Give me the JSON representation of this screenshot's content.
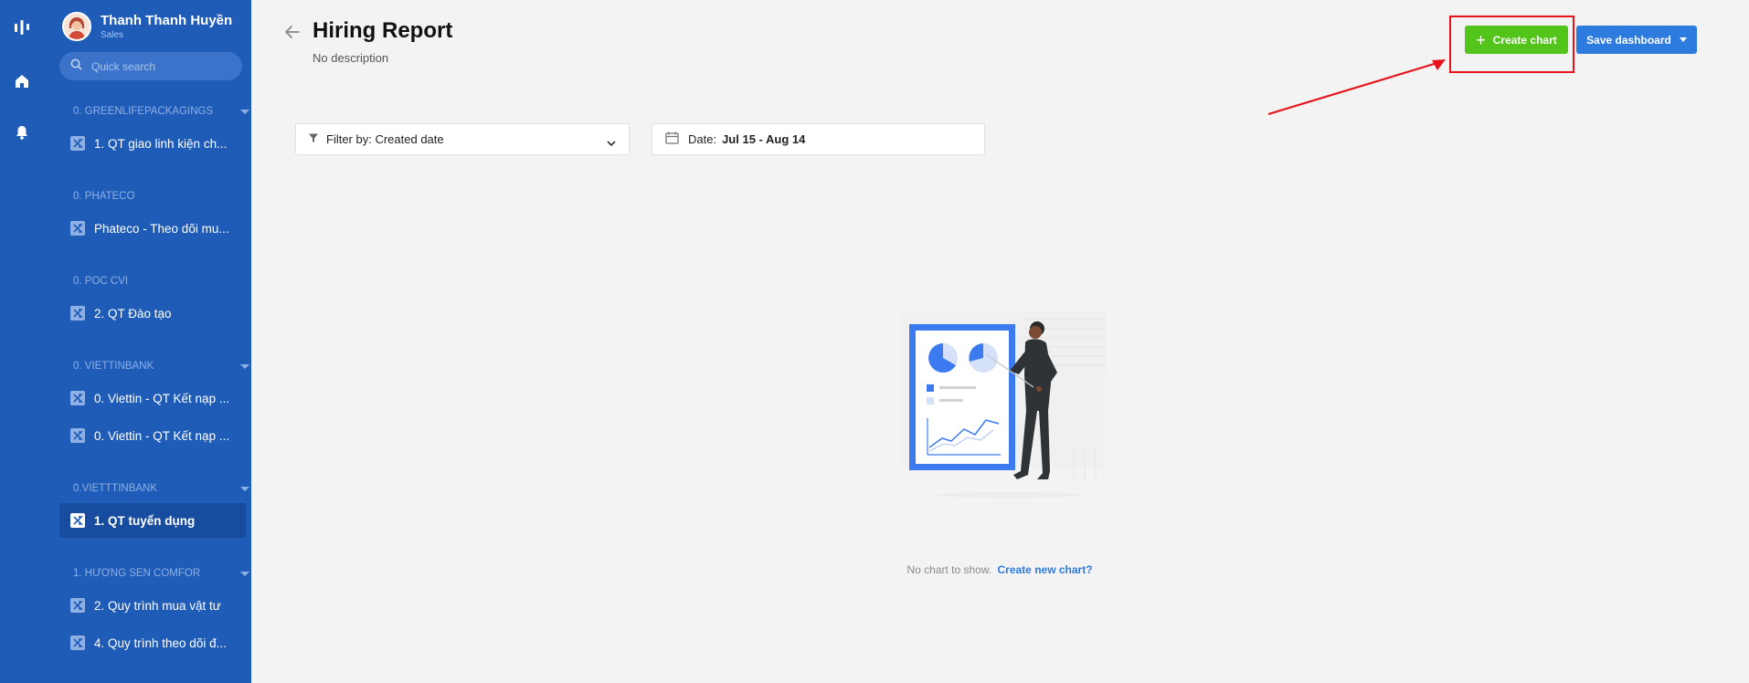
{
  "rail": {
    "icons": [
      "logo-icon",
      "home-icon",
      "bell-icon"
    ]
  },
  "user": {
    "name": "Thanh Thanh Huyền",
    "role": "Sales"
  },
  "search": {
    "placeholder": "Quick search"
  },
  "sidebar": {
    "groups": [
      {
        "label": "0. GREENLIFEPACKAGINGS",
        "items": [
          {
            "label": "1. QT giao linh kiện ch..."
          }
        ]
      },
      {
        "label": "0. PHATECO",
        "items": [
          {
            "label": "Phateco - Theo dõi mu..."
          }
        ]
      },
      {
        "label": "0. POC CVI",
        "items": [
          {
            "label": "2. QT Đào tạo"
          }
        ]
      },
      {
        "label": "0. VIETTINBANK",
        "items": [
          {
            "label": "0. Viettin - QT Kết nạp ..."
          },
          {
            "label": "0. Viettin - QT Kết nạp ..."
          }
        ]
      },
      {
        "label": "0.VIETTTINBANK",
        "items": [
          {
            "label": "1. QT tuyển dụng",
            "active": true
          }
        ]
      },
      {
        "label": "1. HƯƠNG SEN COMFOR",
        "items": [
          {
            "label": "2. Quy trình mua vật tư"
          },
          {
            "label": "4. Quy trình theo dõi đ..."
          }
        ]
      }
    ]
  },
  "page": {
    "title": "Hiring Report",
    "description": "No description"
  },
  "toolbar": {
    "create_label": "Create chart",
    "save_label": "Save dashboard"
  },
  "filter": {
    "label": "Filter by: Created date"
  },
  "date": {
    "label": "Date:",
    "value": "Jul 15 - Aug 14"
  },
  "empty_state": {
    "text": "No chart to show.",
    "link": "Create new chart?"
  },
  "colors": {
    "sidebar": "#1e5cb8",
    "create_button": "#52c41a",
    "save_button": "#2e7be0",
    "annotation": "#e6141a"
  }
}
